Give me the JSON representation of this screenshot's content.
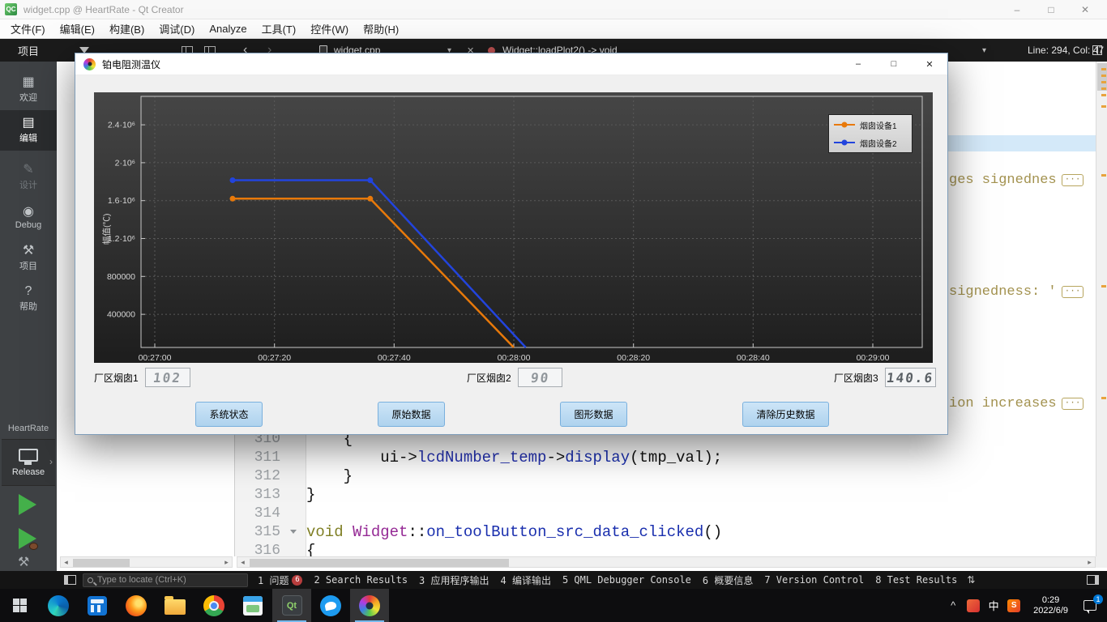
{
  "glyphs": {
    "minimize": "–",
    "maximize": "□",
    "close": "✕",
    "caret": "▾",
    "back": "‹",
    "forward": "›",
    "chevron_up": "^",
    "updown": "⇅",
    "arrow_right": "›"
  },
  "icon_glyphs": {
    "welcome": "▦",
    "edit": "▤",
    "design": "✎",
    "debug": "◉",
    "projects": "⚒",
    "help": "?",
    "hammer": "⚒"
  },
  "qtcreator": {
    "titlebar": {
      "title": "widget.cpp @ HeartRate - Qt Creator"
    },
    "menus": [
      "文件(F)",
      "编辑(E)",
      "构建(B)",
      "调试(D)",
      "Analyze",
      "工具(T)",
      "控件(W)",
      "帮助(H)"
    ],
    "toolbar": {
      "nav_pane_title": "项目",
      "file_name": "widget.cpp",
      "symbol": "Widget::loadPlot2() -> void",
      "line_col": "Line: 294, Col: 47"
    },
    "modes": [
      {
        "label": "欢迎",
        "icon": "welcome"
      },
      {
        "label": "编辑",
        "icon": "edit",
        "active": true
      },
      {
        "label": "设计",
        "icon": "design",
        "disabled": true
      },
      {
        "label": "Debug",
        "icon": "debug"
      },
      {
        "label": "项目",
        "icon": "projects"
      },
      {
        "label": "帮助",
        "icon": "help"
      }
    ],
    "kit": {
      "project": "HeartRate",
      "config": "Release"
    },
    "editor": {
      "lines": [
        {
          "num": "310",
          "tokens": [
            {
              "t": "    {",
              "c": "p"
            }
          ]
        },
        {
          "num": "311",
          "tokens": [
            {
              "t": "        ui->",
              "c": "p"
            },
            {
              "t": "lcdNumber_temp",
              "c": "fld"
            },
            {
              "t": "->",
              "c": "p"
            },
            {
              "t": "display",
              "c": "fn"
            },
            {
              "t": "(tmp_val);",
              "c": "p"
            }
          ]
        },
        {
          "num": "312",
          "tokens": [
            {
              "t": "    }",
              "c": "p"
            }
          ]
        },
        {
          "num": "313",
          "tokens": [
            {
              "t": "}",
              "c": "p"
            }
          ]
        },
        {
          "num": "314",
          "tokens": []
        },
        {
          "num": "315",
          "fold": true,
          "tokens": [
            {
              "t": "void ",
              "c": "kw"
            },
            {
              "t": "Widget",
              "c": "type"
            },
            {
              "t": "::",
              "c": "p"
            },
            {
              "t": "on_toolButton_src_data_clicked",
              "c": "fn"
            },
            {
              "t": "()",
              "c": "p"
            }
          ]
        },
        {
          "num": "316",
          "tokens": [
            {
              "t": "{",
              "c": "p"
            }
          ]
        }
      ],
      "annotations": [
        {
          "text": "ges signednes"
        },
        {
          "text": "signedness: '"
        },
        {
          "text": "ion increases"
        }
      ],
      "ellipsis": "···"
    },
    "bottombar": {
      "locator_placeholder": "Type to locate (Ctrl+K)",
      "panes": [
        {
          "label": "1 问题",
          "badge": "6"
        },
        {
          "label": "2 Search Results"
        },
        {
          "label": "3 应用程序输出"
        },
        {
          "label": "4 编译输出"
        },
        {
          "label": "5 QML Debugger Console"
        },
        {
          "label": "6 概要信息"
        },
        {
          "label": "7 Version Control"
        },
        {
          "label": "8 Test Results"
        }
      ]
    }
  },
  "app": {
    "title": "铂电阻测温仪",
    "lcds": [
      {
        "label": "厂区烟囱1",
        "value": "102"
      },
      {
        "label": "厂区烟囱2",
        "value": "90"
      },
      {
        "label": "厂区烟囱3",
        "value": "140.6"
      }
    ],
    "buttons": [
      "系统状态",
      "原始数据",
      "图形数据",
      "清除历史数据"
    ]
  },
  "chart_data": {
    "type": "line",
    "title": "",
    "xlabel": "",
    "ylabel": "幅值(℃)",
    "xlim": [
      "00:27:00",
      "00:29:00"
    ],
    "ylim": [
      50000,
      2700000
    ],
    "grid": true,
    "legend_position": "top-right",
    "x_ticks": [
      "00:27:00",
      "00:27:20",
      "00:27:40",
      "00:28:00",
      "00:28:20",
      "00:28:40",
      "00:29:00"
    ],
    "y_ticks": [
      {
        "value": 2400000,
        "label": "2.4·10⁶"
      },
      {
        "value": 2000000,
        "label": "2·10⁶"
      },
      {
        "value": 1600000,
        "label": "1.6·10⁶"
      },
      {
        "value": 1200000,
        "label": "1.2·10⁶"
      },
      {
        "value": 800000,
        "label": "800000"
      },
      {
        "value": 400000,
        "label": "400000"
      }
    ],
    "series": [
      {
        "name": "烟囱设备1",
        "color": "#e8790a",
        "points": [
          [
            "00:27:13",
            1620000
          ],
          [
            "00:27:36",
            1620000
          ],
          [
            "00:28:00",
            50000
          ]
        ]
      },
      {
        "name": "烟囱设备2",
        "color": "#2244dd",
        "points": [
          [
            "00:27:13",
            1815000
          ],
          [
            "00:27:36",
            1815000
          ],
          [
            "00:28:02",
            50000
          ]
        ]
      }
    ]
  },
  "taskbar": {
    "icons": [
      {
        "name": "edge"
      },
      {
        "name": "calcul ator_placeholder_unused"
      },
      {
        "name": "firefox"
      },
      {
        "name": "file-explorer"
      },
      {
        "name": "chrome"
      },
      {
        "name": "paint"
      },
      {
        "name": "qt-creator",
        "active": true
      },
      {
        "name": "twitter"
      },
      {
        "name": "thermometer-app",
        "active": true
      }
    ],
    "tray": {
      "ime": "中",
      "sogou": "S",
      "time": "0:29",
      "date": "2022/6/9",
      "badge": "1"
    }
  }
}
